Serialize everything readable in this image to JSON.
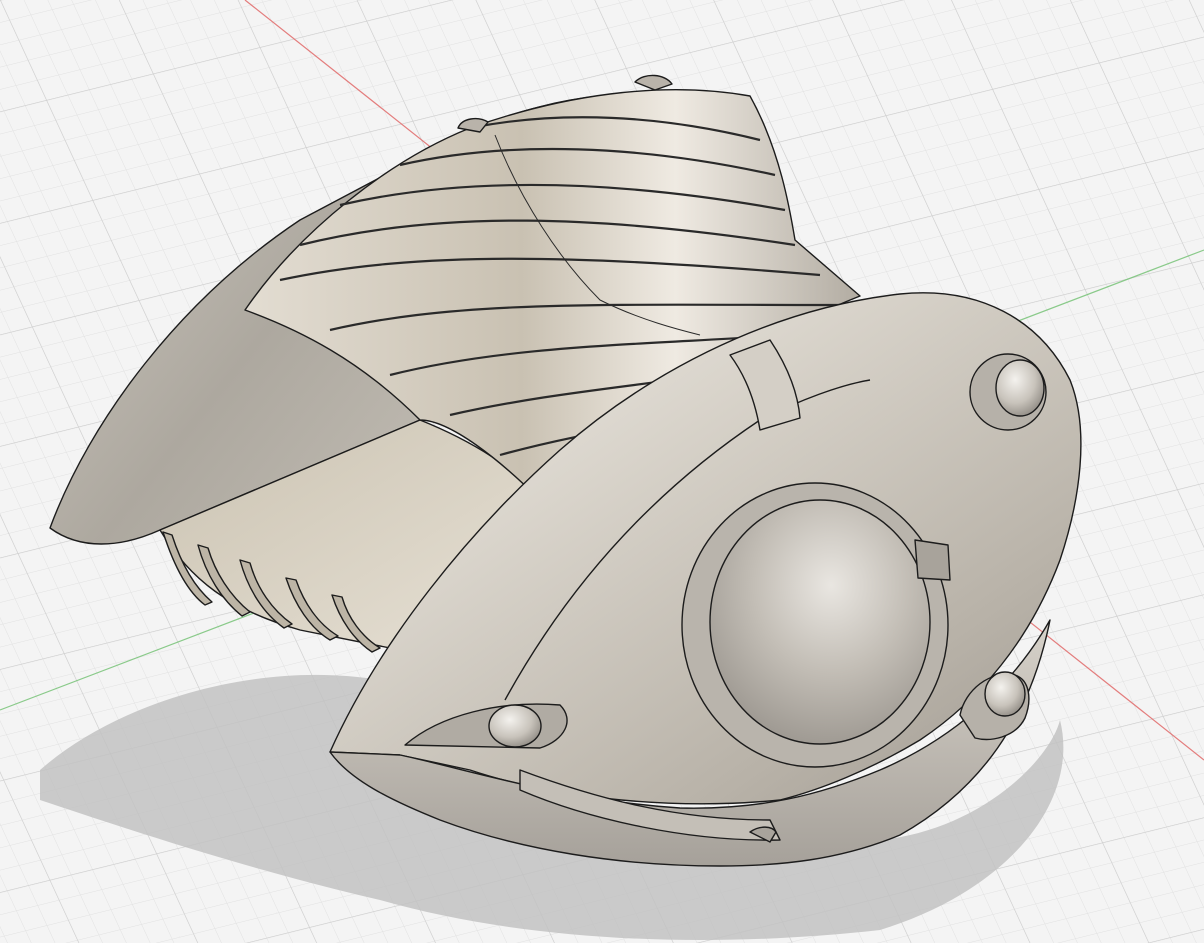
{
  "viewport": {
    "background": "#f4f4f4",
    "grid_minor_color": "#e1e1e1",
    "grid_major_color": "#cdcdcd",
    "axis_red": "#e06060",
    "axis_green": "#70c070"
  },
  "model": {
    "body_color": "#c9c3b8",
    "edge_color": "#1c1c1c",
    "cut_face_color": "#d6cfc0",
    "shadow_color": "#c4c4c4"
  }
}
